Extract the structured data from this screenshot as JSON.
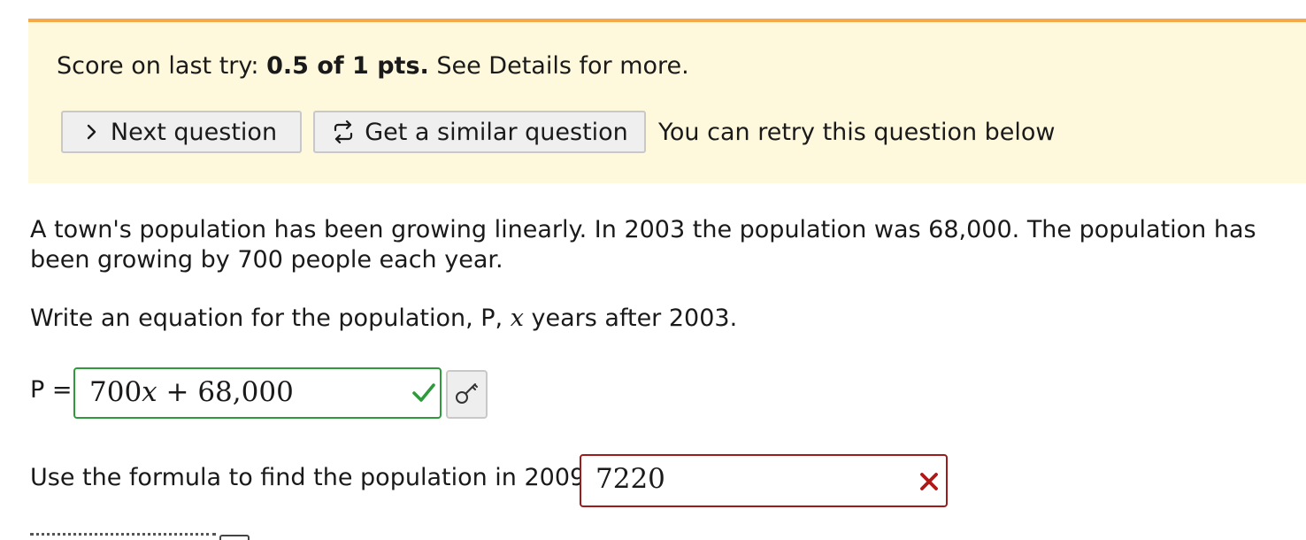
{
  "banner": {
    "score_prefix": "Score on last try: ",
    "score_value": "0.5 of 1 pts.",
    "score_suffix": " See Details for more.",
    "next_button": "Next question",
    "similar_button": "Get a similar question",
    "retry_note": "You can retry this question below",
    "accent_color": "#f6a94a",
    "background_color": "#fef8dd"
  },
  "question": {
    "text": "A town's population has been growing linearly. In 2003 the population was 68,000. The population has been growing by 700 people each year.",
    "prompt_before": "Write an equation for the population, P, ",
    "prompt_var": "x",
    "prompt_after": " years after 2003."
  },
  "part1": {
    "label": "P =",
    "answer_coeff": "700",
    "answer_var": "x",
    "answer_rest": " + 68,000",
    "status": "correct",
    "status_color": "#2f9a3c",
    "key_icon": "key-icon"
  },
  "part2": {
    "label": "Use the formula to find the population in 2009:",
    "answer": "7220",
    "status": "incorrect",
    "status_color": "#9d1b1b"
  },
  "icons": {
    "next": "chevron-right-icon",
    "similar": "retry-arrows-icon",
    "correct": "check-icon",
    "incorrect": "x-icon"
  }
}
